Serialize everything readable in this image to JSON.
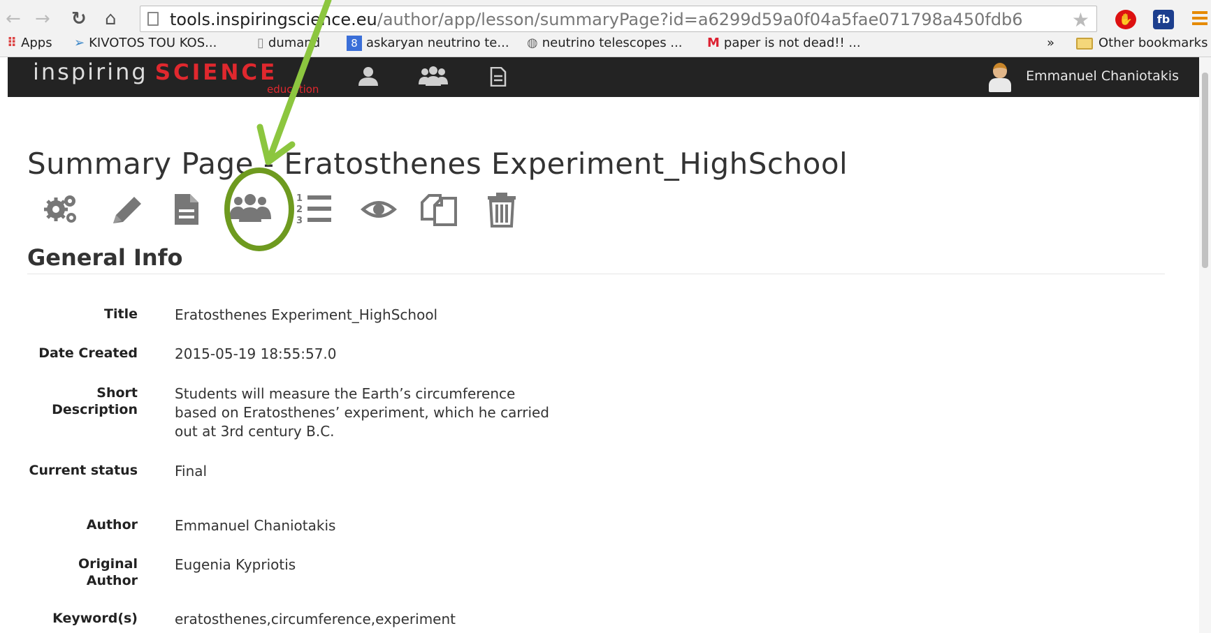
{
  "browser": {
    "url_host": "tools.inspiringscience.eu",
    "url_path": "/author/app/lesson/summaryPage?id=a6299d59a0f04a5fae071798a450fdb6",
    "ext_fb_label": "fb",
    "bookmarks": [
      {
        "label": "Apps"
      },
      {
        "label": "KIVOTOS TOU KOS..."
      },
      {
        "label": "dumand"
      },
      {
        "label": "askaryan neutrino te..."
      },
      {
        "label": "neutrino telescopes ..."
      },
      {
        "label": "paper is not dead!! ..."
      }
    ],
    "more_bookmarks": "»",
    "other_bookmarks": "Other bookmarks"
  },
  "app": {
    "logo_text": "inspiring",
    "logo_science": "SCIENCE",
    "logo_education": "education",
    "user_name": "Emmanuel Chaniotakis"
  },
  "page": {
    "title": "Summary Page - Eratosthenes Experiment_HighSchool",
    "section_title": "General Info",
    "fields": [
      {
        "label": "Title",
        "value": "Eratosthenes Experiment_HighSchool"
      },
      {
        "label": "Date Created",
        "value": "2015-05-19 18:55:57.0"
      },
      {
        "label": "Short Description",
        "value": "Students will measure the Earth’s circumference based on Eratosthenes’ experiment, which he carried out at 3rd century B.C."
      },
      {
        "label": "Current status",
        "value": "Final"
      },
      {
        "label": "Author",
        "value": "Emmanuel Chaniotakis"
      },
      {
        "label": "Original Author",
        "value": "Eugenia Kypriotis"
      },
      {
        "label": "Keyword(s)",
        "value": "eratosthenes,circumference,experiment"
      }
    ]
  },
  "toolbar_icons": [
    "gears-icon",
    "pencil-icon",
    "document-icon",
    "users-icon",
    "ordered-list-icon",
    "eye-icon",
    "copy-icon",
    "trash-icon"
  ],
  "colors": {
    "app_bar": "#232323",
    "brand_red": "#e0282e",
    "annotation_green": "#8cc63f",
    "annotation_circle": "#6e9a1f"
  }
}
